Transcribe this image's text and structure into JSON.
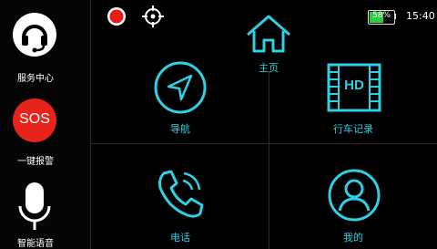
{
  "sidebar": {
    "items": [
      {
        "label": "服务中心",
        "icon": "headset-icon"
      },
      {
        "label": "一键报警",
        "icon": "sos-icon",
        "badge": "SOS"
      },
      {
        "label": "智能语音",
        "icon": "microphone-icon"
      }
    ]
  },
  "status": {
    "record_icon": "record-dot-icon",
    "locate_icon": "crosshair-icon",
    "battery_percent": "58%",
    "battery_level": 0.58,
    "time": "15:40"
  },
  "main": {
    "home_label": "主页",
    "tiles": [
      {
        "label": "导航",
        "icon": "navigation-arrow-icon"
      },
      {
        "label": "行车记录",
        "icon": "hd-video-icon",
        "icon_text": "HD"
      },
      {
        "label": "电话",
        "icon": "phone-icon"
      },
      {
        "label": "我的",
        "icon": "user-profile-icon"
      }
    ]
  },
  "colors": {
    "accent": "#2fd0e3",
    "sos_red": "#e8231c",
    "record_red": "#e81b1b",
    "battery_green": "#2ecc40"
  }
}
